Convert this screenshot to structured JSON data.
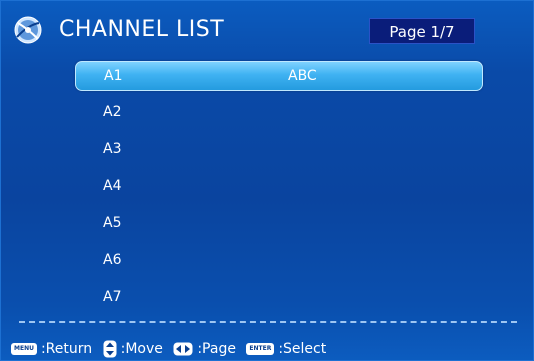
{
  "header": {
    "title": "CHANNEL LIST",
    "page_indicator": "Page 1/7",
    "logo_icon": "satellite-logo-icon"
  },
  "channels": [
    {
      "name": "A1",
      "program": "ABC",
      "selected": true
    },
    {
      "name": "A2",
      "program": ""
    },
    {
      "name": "A3",
      "program": ""
    },
    {
      "name": "A4",
      "program": ""
    },
    {
      "name": "A5",
      "program": ""
    },
    {
      "name": "A6",
      "program": ""
    },
    {
      "name": "A7",
      "program": ""
    }
  ],
  "footer": {
    "menu_key": "MENU",
    "return_label": ":Return",
    "move_icon": "up-down-arrow-icon",
    "move_label": ":Move",
    "page_icon": "left-right-arrow-icon",
    "page_label": ":Page",
    "enter_key": "ENTER",
    "select_label": ":Select"
  },
  "colors": {
    "background": "#0a4aa8",
    "selected_row": "#3fb2f2",
    "page_badge": "#0a1d7a"
  }
}
